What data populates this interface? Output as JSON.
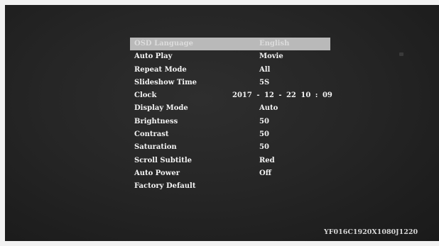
{
  "menu": {
    "items": [
      {
        "label": "OSD Language",
        "value": "English",
        "selected": true
      },
      {
        "label": "Auto Play",
        "value": "Movie"
      },
      {
        "label": "Repeat Mode",
        "value": "All"
      },
      {
        "label": "Slideshow Time",
        "value": "5S"
      },
      {
        "label": "Clock",
        "value": "2017 - 12 - 22   10 : 09"
      },
      {
        "label": "Display Mode",
        "value": "Auto"
      },
      {
        "label": "Brightness",
        "value": "50"
      },
      {
        "label": "Contrast",
        "value": "50"
      },
      {
        "label": "Saturation",
        "value": "50"
      },
      {
        "label": "Scroll Subtitle",
        "value": "Red"
      },
      {
        "label": "Auto Power",
        "value": "Off"
      },
      {
        "label": "Factory Default",
        "value": ""
      }
    ]
  },
  "footer": {
    "model_code": "YF016C1920X1080J1220"
  },
  "colors": {
    "screen_background": "#262626",
    "highlight": "#b9b9b9",
    "text": "#f4f4f4"
  }
}
